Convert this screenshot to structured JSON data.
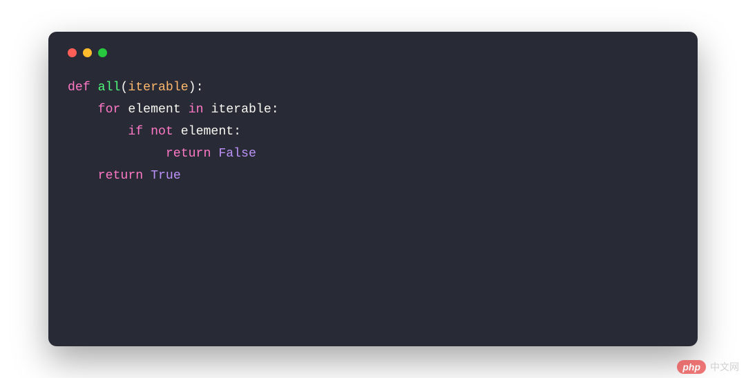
{
  "code": {
    "line1": {
      "def": "def",
      "name": "all",
      "lp": "(",
      "param": "iterable",
      "rp": "):"
    },
    "line2": {
      "for": "for",
      "el": "element",
      "in": "in",
      "iter": "iterable",
      "colon": ":"
    },
    "line3": {
      "if": "if",
      "not": "not",
      "el": "element",
      "colon": ":"
    },
    "line4": {
      "ret": "return",
      "val": "False"
    },
    "line5": {
      "ret": "return",
      "val": "True"
    }
  },
  "watermark": {
    "badge": "php",
    "text": "中文网"
  }
}
